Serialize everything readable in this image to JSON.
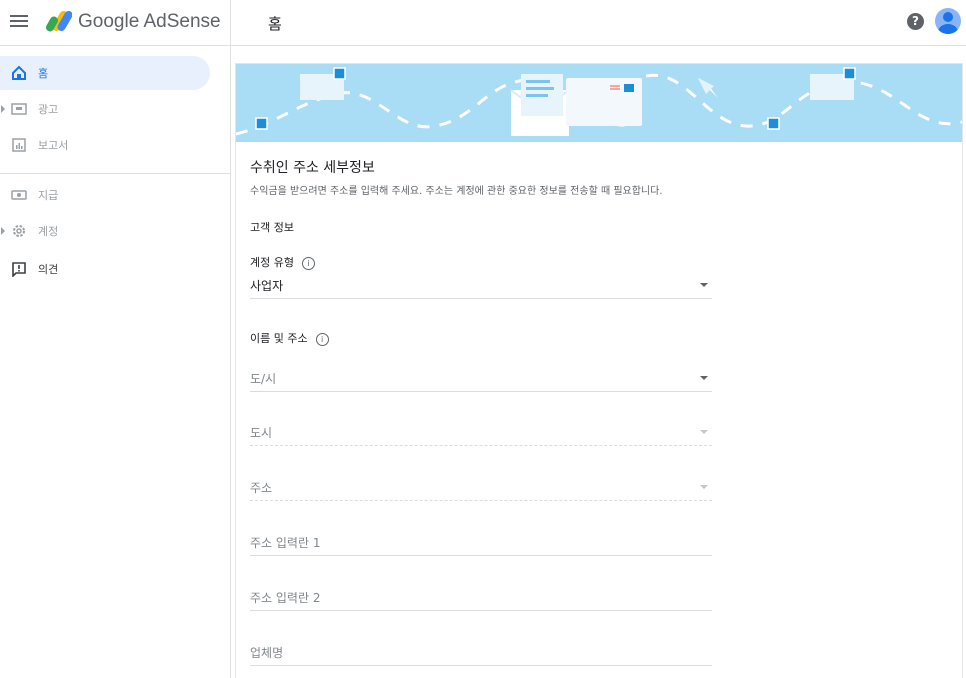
{
  "header": {
    "brand": "Google AdSense",
    "page_title": "홈",
    "help_symbol": "?"
  },
  "sidebar": {
    "items": [
      {
        "label": "홈",
        "icon": "home-icon",
        "active": true
      },
      {
        "label": "광고",
        "icon": "ads-icon"
      },
      {
        "label": "보고서",
        "icon": "reports-icon"
      },
      {
        "label": "지급",
        "icon": "payments-icon"
      },
      {
        "label": "계정",
        "icon": "gear-icon"
      },
      {
        "label": "의견",
        "icon": "feedback-icon"
      }
    ]
  },
  "main": {
    "section_title": "수취인 주소 세부정보",
    "section_desc": "수익금을 받으려면 주소를 입력해 주세요. 주소는 계정에 관한 중요한 정보를 전송할 때 필요합니다.",
    "customer_info": "고객 정보",
    "account_type_label": "계정 유형",
    "account_type_value": "사업자",
    "name_address_label": "이름 및 주소",
    "info_symbol": "i",
    "fields": {
      "province": "도/시",
      "city": "도시",
      "address": "주소",
      "address_line1": "주소 입력란 1",
      "address_line2": "주소 입력란 2",
      "business_name": "업체명"
    }
  },
  "colors": {
    "accent": "#1a73e8",
    "banner": "#a9dcf5",
    "active_bg": "#e8f0fe"
  }
}
